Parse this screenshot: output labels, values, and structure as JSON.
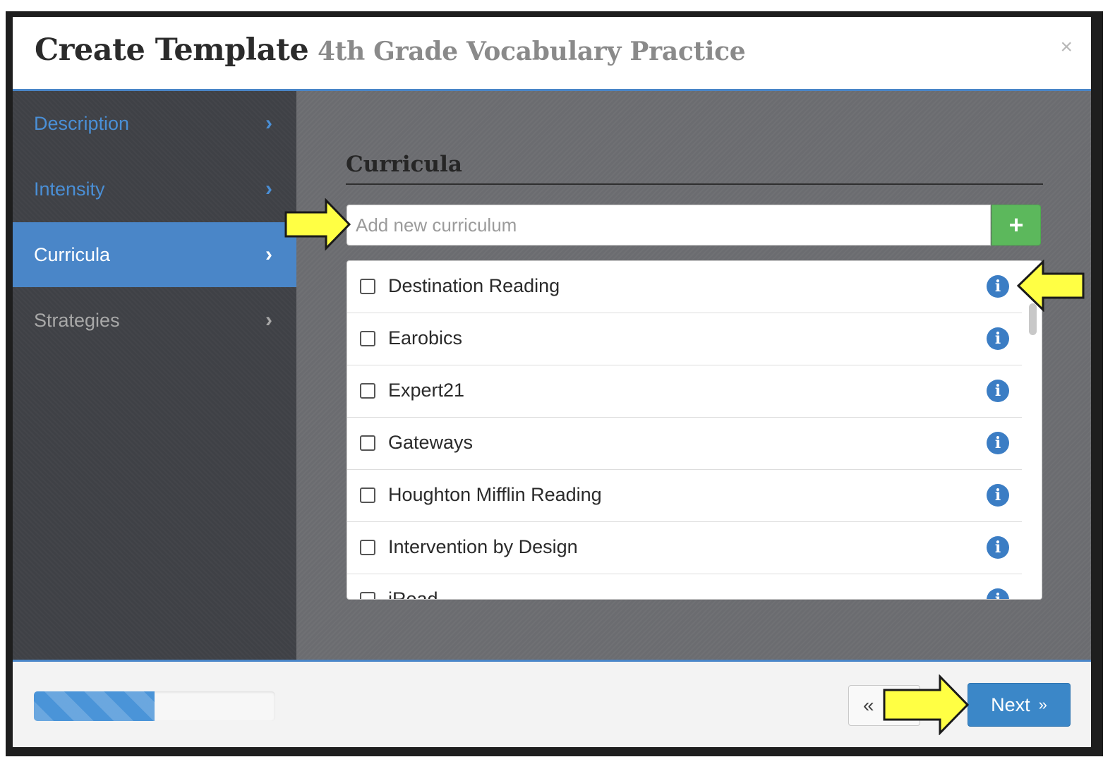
{
  "modal": {
    "title": "Create Template",
    "subtitle": "4th Grade Vocabulary Practice",
    "close_label": "×"
  },
  "sidebar": {
    "items": [
      {
        "label": "Description",
        "state": "done"
      },
      {
        "label": "Intensity",
        "state": "done"
      },
      {
        "label": "Curricula",
        "state": "active"
      },
      {
        "label": "Strategies",
        "state": "pending"
      }
    ],
    "chevron": "›"
  },
  "main": {
    "section_title": "Curricula",
    "add_input": {
      "placeholder": "Add new curriculum",
      "value": ""
    },
    "add_button_label": "+",
    "info_glyph": "i",
    "curricula": [
      {
        "label": "Destination Reading",
        "checked": false
      },
      {
        "label": "Earobics",
        "checked": false
      },
      {
        "label": "Expert21",
        "checked": false
      },
      {
        "label": "Gateways",
        "checked": false
      },
      {
        "label": "Houghton Mifflin Reading",
        "checked": false
      },
      {
        "label": "Intervention by Design",
        "checked": false
      },
      {
        "label": "iRead",
        "checked": false
      }
    ]
  },
  "footer": {
    "progress": 0.5,
    "prev_label": "«",
    "next_label": "Next",
    "next_icon": "»"
  },
  "colors": {
    "accent": "#4a86c8",
    "add_button": "#5cb85c",
    "info_icon": "#3b7dc4",
    "callout_arrow": "#ffff44"
  },
  "icons": [
    "close-icon",
    "chevron-right-icon",
    "plus-icon",
    "info-icon",
    "double-chevron-left-icon",
    "double-chevron-right-icon",
    "callout-arrow-icon"
  ]
}
